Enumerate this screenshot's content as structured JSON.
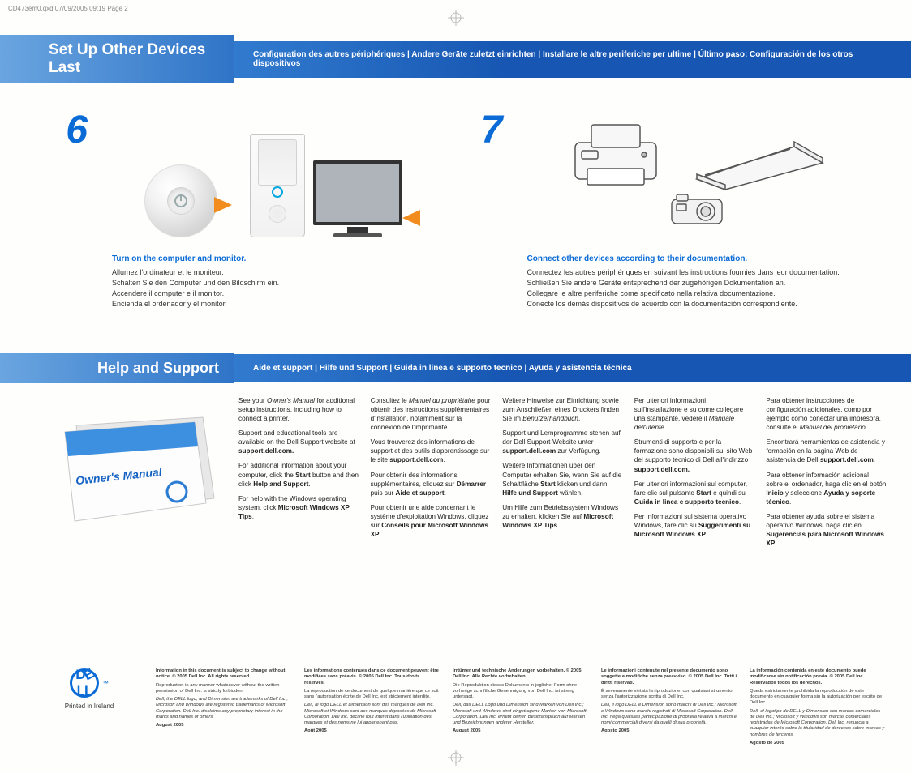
{
  "print_header": "CD473em0.qxd  07/09/2005  09:19  Page 2",
  "band1": {
    "title": "Set Up Other Devices Last",
    "subtitle": "Configuration des autres périphériques | Andere Geräte zuletzt einrichten | Installare le altre periferiche per ultime | Último paso: Configuración de los otros dispositivos"
  },
  "step6": {
    "num": "6",
    "heading": "Turn on the computer and monitor.",
    "lines": [
      "Allumez l'ordinateur et le moniteur.",
      "Schalten Sie den Computer und den Bildschirm ein.",
      "Accendere il computer e il monitor.",
      "Encienda el ordenador y el monitor."
    ]
  },
  "step7": {
    "num": "7",
    "heading": "Connect other devices according to their documentation.",
    "lines": [
      "Connectez les autres périphériques en suivant les instructions fournies dans leur documentation.",
      "Schließen Sie andere Geräte entsprechend der zugehörigen Dokumentation an.",
      "Collegare le altre periferiche come specificato nella relativa documentazione.",
      "Conecte los demás dispositivos de acuerdo con la documentación correspondiente."
    ]
  },
  "band2": {
    "title": "Help and Support",
    "subtitle": "Aide et support | Hilfe und Support | Guida in linea e supporto tecnico | Ayuda y asistencia técnica"
  },
  "help_en": {
    "p1a": "See your ",
    "p1i": "Owner's Manual",
    "p1b": " for additional setup instructions, including how to connect a printer.",
    "p2a": "Support and educational tools are available on the Dell Support website at ",
    "p2b1": "support.dell.com.",
    "p3a": "For additional information about your computer, click the ",
    "p3b1": "Start",
    "p3m": " button and then click ",
    "p3b2": "Help and Support",
    "p3z": ".",
    "p4a": "For help with the Windows operating system, click ",
    "p4b": "Microsoft Windows XP Tips",
    "p4z": "."
  },
  "help_fr": {
    "p1a": "Consultez le ",
    "p1i": "Manuel du propriétaire",
    "p1b": " pour obtenir des instructions supplémentaires d'installation, notamment sur la connexion de l'imprimante.",
    "p2a": "Vous trouverez des informations de support et des outils d'apprentissage sur le site ",
    "p2b1": "support.dell.com",
    "p2z": ".",
    "p3a": "Pour obtenir des informations supplémentaires, cliquez sur ",
    "p3b1": "Démarrer",
    "p3m": " puis sur ",
    "p3b2": "Aide et support",
    "p3z": ".",
    "p4a": "Pour obtenir une aide concernant le système d'exploitation Windows, cliquez sur ",
    "p4b": "Conseils pour Microsoft Windows XP",
    "p4z": "."
  },
  "help_de": {
    "p1a": "Weitere Hinweise zur Einrichtung sowie zum Anschließen eines Druckers finden Sie im ",
    "p1i": "Benutzerhandbuch",
    "p1z": ".",
    "p2a": "Support und Lernprogramme stehen auf der Dell Support-Website unter ",
    "p2b1": "support.dell.com",
    "p2m": " zur Verfügung.",
    "p3a": "Weitere Informationen über den Computer erhalten Sie, wenn Sie auf die Schaltfläche ",
    "p3b1": "Start",
    "p3m": " klicken und dann ",
    "p3b2": "Hilfe und Support",
    "p3z": " wählen.",
    "p4a": "Um Hilfe zum Betriebssystem Windows zu erhalten, klicken Sie auf ",
    "p4b": "Microsoft Windows XP Tips",
    "p4z": "."
  },
  "help_it": {
    "p1a": "Per ulteriori informazioni sull'installazione e su come collegare una stampante, vedere il ",
    "p1i": "Manuale dell'utente",
    "p1z": ".",
    "p2a": "Strumenti di supporto e per la formazione sono disponibili sul sito Web del supporto tecnico di Dell all'indirizzo ",
    "p2b1": "support.dell.com.",
    "p3a": "Per ulteriori informazioni sul computer, fare clic sul pulsante ",
    "p3b1": "Start",
    "p3m": " e quindi su ",
    "p3b2": "Guida in linea e supporto tecnico",
    "p3z": ".",
    "p4a": "Per informazioni sul sistema operativo Windows, fare clic su ",
    "p4b": "Suggerimenti su Microsoft Windows XP",
    "p4z": "."
  },
  "help_es": {
    "p1a": "Para obtener instrucciones de configuración adicionales, como por ejemplo cómo conectar una impresora, consulte el ",
    "p1i": "Manual del propietario",
    "p1z": ".",
    "p2a": "Encontrará herramientas de asistencia y formación en la página Web de asistencia de Dell ",
    "p2b1": "support.dell.com",
    "p2z": ".",
    "p3a": "Para obtener información adicional sobre el ordenador, haga clic en el botón ",
    "p3b1": "Inicio",
    "p3m": " y seleccione ",
    "p3b2": "Ayuda y soporte técnico",
    "p3z": ".",
    "p4a": "Para obtener ayuda sobre el sistema operativo Windows, haga clic en ",
    "p4b": "Sugerencias para Microsoft Windows XP",
    "p4z": "."
  },
  "footer": {
    "printed": "Printed in Ireland",
    "en": {
      "l1": "Information in this document is subject to change without notice.\n© 2005 Dell Inc. All rights reserved.",
      "l2": "Reproduction in any manner whatsoever without the written permission of Dell Inc. is strictly forbidden.",
      "l3": "Dell, the DELL logo, and Dimension are trademarks of Dell Inc.; Microsoft and Windows are registered trademarks of Microsoft Corporation. Dell Inc. disclaims any proprietary interest in the marks and names of others.",
      "l4": "August 2005"
    },
    "fr": {
      "l1": "Les informations contenues dans ce document peuvent être modifiées sans préavis.\n© 2005 Dell Inc. Tous droits réservés.",
      "l2": "La reproduction de ce document de quelque manière que ce soit sans l'autorisation écrite de Dell Inc. est strictement interdite.",
      "l3": "Dell, le logo DELL et Dimension sont des marques de Dell Inc. ; Microsoft et Windows sont des marques déposées de Microsoft Corporation. Dell Inc. décline tout intérêt dans l'utilisation des marques et des noms ne lui appartenant pas.",
      "l4": "Août 2005"
    },
    "de": {
      "l1": "Irrtümer und technische Änderungen vorbehalten.\n© 2005 Dell Inc. Alle Rechte vorbehalten.",
      "l2": "Die Reproduktion dieses Dokuments in jeglicher Form ohne vorherige schriftliche Genehmigung von Dell Inc. ist streng untersagt.",
      "l3": "Dell, das DELL Logo und Dimension sind Marken von Dell Inc.; Microsoft und Windows sind eingetragene Marken von Microsoft Corporation. Dell Inc. erhebt keinen Besitzanspruch auf Marken und Bezeichnungen anderer Hersteller.",
      "l4": "August 2005"
    },
    "it": {
      "l1": "Le informazioni contenute nel presente documento sono soggette a modifiche senza preavviso.\n© 2005 Dell Inc. Tutti i diritti riservati.",
      "l2": "È severamente vietata la riproduzione, con qualsiasi strumento, senza l'autorizzazione scritta di Dell Inc.",
      "l3": "Dell, il logo DELL e Dimension sono marchi di Dell Inc.; Microsoft e Windows sono marchi registrati di Microsoft Corporation. Dell Inc. nega qualsiasi partecipazione di proprietà relativa a marchi e nomi commerciali diversi da quelli di sua proprietà.",
      "l4": "Agosto 2005"
    },
    "es": {
      "l1": "La información contenida en este documento puede modificarse sin notificación previa.\n© 2005 Dell Inc. Reservados todos los derechos.",
      "l2": "Queda estrictamente prohibida la reproducción de este documento en cualquier forma sin la autorización por escrito de Dell Inc.",
      "l3": "Dell, el logotipo de DELL y Dimension son marcas comerciales de Dell Inc.; Microsoft y Windows son marcas comerciales registradas de Microsoft Corporation. Dell Inc. renuncia a cualquier interés sobre la titularidad de derechos sobre marcas y nombres de terceros.",
      "l4": "Agosto de 2005"
    }
  },
  "manual_label": "Owner's Manual"
}
